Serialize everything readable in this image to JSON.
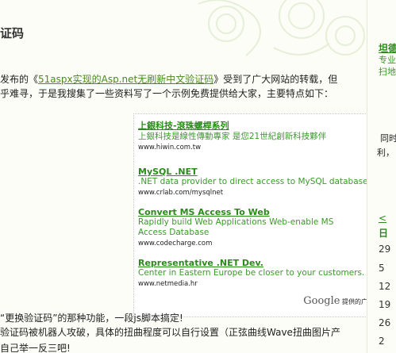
{
  "article": {
    "title": "证码",
    "line1_prefix": "发布的《",
    "line1_link": "51aspx实现的Asp.net无刷新中文验证码",
    "line1_suffix": "》受到了广大网站的转载，但",
    "line2": "乎难寻，于是我搜集了一些资料写了一个示例免费提供给大家，主要特点如下：",
    "line3": "“更换验证码”的那种功能，一段js脚本搞定!",
    "line4": "验证码被机器人攻破，具体的扭曲程度可以自行设置（正弦曲线Wave扭曲图片产",
    "line5": "自己举一反三吧!"
  },
  "ads": [
    {
      "title": "上銀科技-滾珠螺桿系列",
      "desc": "上銀科技是線性傳動專家 是您21世紀創新科技夥伴",
      "url": "www.hiwin.com.tw"
    },
    {
      "title": "MySQL .NET",
      "desc": ".NET data provider to direct access to MySQL database",
      "url": "www.crlab.com/mysqlnet"
    },
    {
      "title": "Convert MS Access To Web",
      "desc": "Rapidly build Web Applications Web-enable MS Access Database",
      "url": "www.codecharge.com"
    },
    {
      "title": "Representative .NET Dev.",
      "desc": "Center in Eastern Europe be closer to your customers.",
      "url": "www.netmedia.hr"
    }
  ],
  "google_footer": {
    "logo": "Google",
    "text": "提供的广"
  },
  "sidebar": {
    "link": "坦德",
    "text1": "专业",
    "text2": "扫地",
    "text3": "同时",
    "text4": "利，",
    "cal_nav": "<",
    "cal_head": "日",
    "cal_days": [
      "29",
      "5",
      "12",
      "19",
      "26",
      "2"
    ]
  }
}
